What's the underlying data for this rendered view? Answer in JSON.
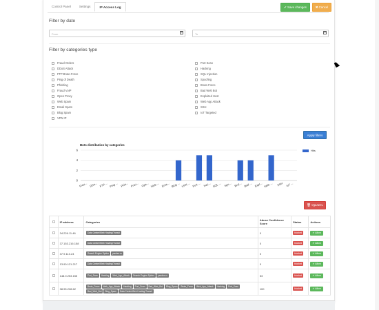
{
  "tabs": [
    {
      "label": "Control Panel"
    },
    {
      "label": "Settings"
    },
    {
      "label": "IP Access Log"
    }
  ],
  "toolbar": {
    "save_label": "✔ Save changes",
    "cancel_label": "✖ Cancel"
  },
  "filter_date": {
    "title": "Filter by date",
    "from_placeholder": "From",
    "to_placeholder": "To"
  },
  "filter_categories": {
    "title": "Filter by categories type",
    "left": [
      "Fraud Orders",
      "DDoS Attack",
      "FTP Brute-Force",
      "Ping of Death",
      "Phishing",
      "Fraud VoIP",
      "Open Proxy",
      "Web Spam",
      "Email Spam",
      "Blog Spam",
      "VPN IP"
    ],
    "right": [
      "Port Scan",
      "Hacking",
      "SQL Injection",
      "Spoofing",
      "Brute-Force",
      "Bad Web Bot",
      "Exploited Host",
      "Web App Attack",
      "SSH",
      "IoT Targeted"
    ]
  },
  "apply_label": "Apply filters",
  "chart_data": {
    "type": "bar",
    "title": "Bots distribution by categories",
    "legend": [
      "Hits"
    ],
    "legend_position": "right",
    "ylim": [
      0,
      6
    ],
    "yticks": [
      0,
      2,
      4,
      6
    ],
    "grid": true,
    "categories": [
      "Frau...",
      "DDo...",
      "FTP ...",
      "Ping ...",
      "Phis...",
      "Frau...",
      "Ope...",
      "Web ...",
      "Ema...",
      "Blog ...",
      "VPN ...",
      "Port ...",
      "Hac...",
      "SQL ...",
      "Spo...",
      "Brut...",
      "Bad ...",
      "Expl...",
      "Web ...",
      "SSH",
      "IoT ..."
    ],
    "series": [
      {
        "name": "Hits",
        "values": [
          0,
          0,
          0,
          0,
          0,
          0,
          0,
          0,
          0,
          4,
          0,
          5,
          5,
          0,
          0,
          4,
          4,
          0,
          5,
          0,
          0
        ]
      }
    ],
    "color": "#3366cc"
  },
  "delete_label": "🗑 Удалить",
  "table": {
    "headers": [
      "",
      "IP address",
      "Categories",
      "Abuse Confidence Score",
      "Status",
      "Actions"
    ],
    "rows": [
      {
        "ip": "34.226.11.46",
        "tags": [
          "Data Center/Web Hosting/Transit"
        ],
        "score": "0",
        "status": "blocked",
        "action": "✔ Allow"
      },
      {
        "ip": "37.153.216.158",
        "tags": [
          "Data Center/Web Hosting/Transit"
        ],
        "score": "0",
        "status": "blocked",
        "action": "✔ Allow"
      },
      {
        "ip": "37.9.113.24",
        "tags": [
          "Search Engine Spider",
          "yandex.ru"
        ],
        "score": "0",
        "status": "blocked",
        "action": "✔ Allow"
      },
      {
        "ip": "13.90.121.217",
        "tags": [
          "Data Center/Web Hosting/Transit"
        ],
        "score": "0",
        "status": "blocked",
        "action": "✔ Allow"
      },
      {
        "ip": "148.0.253.155",
        "tags": [
          "Port_Scan",
          "Hacking",
          "Web_App_Attack",
          "Search Engine Spider",
          "yandex.ru"
        ],
        "score": "53",
        "status": "blocked",
        "action": "✔ Allow"
      },
      {
        "ip": "38.95.228.62",
        "tags": [
          "Brute_Force",
          "Web_App_Attack",
          "Hacking",
          "Port_Scan",
          "Bad_Web_Bot",
          "Blog_Spam",
          "Brute_Force",
          "Web_App_Attack",
          "Hacking",
          "Port_Scan",
          "Bad_Web_Bot",
          "Blog_Spam",
          "Data Center/Web Hosting/Transit"
        ],
        "score": "100",
        "status": "blocked",
        "action": "✔ Allow"
      }
    ]
  }
}
